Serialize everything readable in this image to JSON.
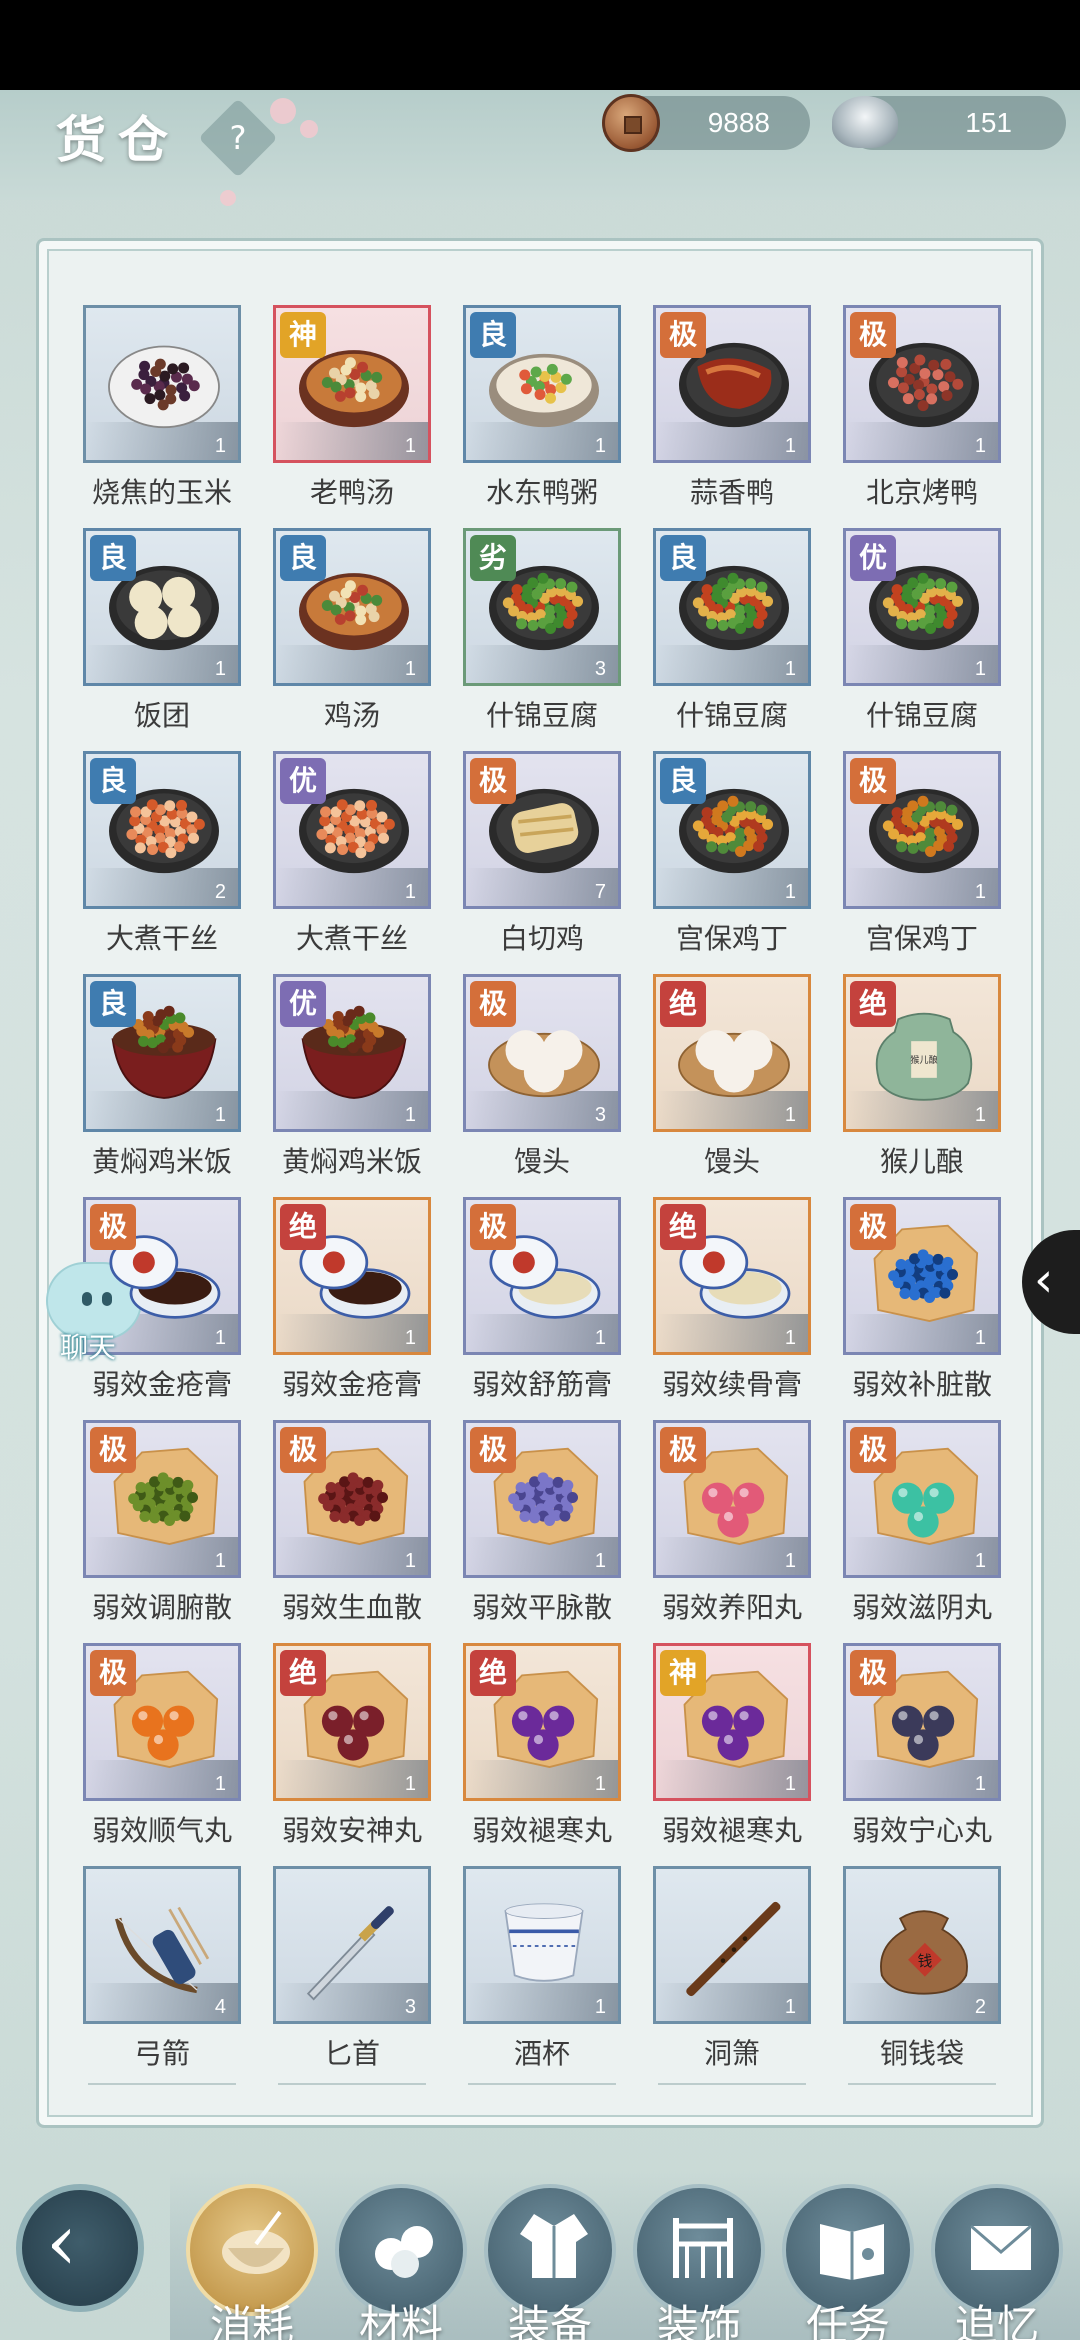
{
  "header": {
    "title": "货仓",
    "help": "?"
  },
  "currency": {
    "copper": "9888",
    "silver": "151"
  },
  "chat": {
    "label": "聊天"
  },
  "side": {
    "toggle": "‹"
  },
  "items": [
    {
      "name": "烧焦的玉米",
      "qty": "1",
      "rank": "",
      "art": "corn"
    },
    {
      "name": "老鸭汤",
      "qty": "1",
      "rank": "神",
      "art": "soup"
    },
    {
      "name": "水东鸭粥",
      "qty": "1",
      "rank": "良",
      "art": "porridge"
    },
    {
      "name": "蒜香鸭",
      "qty": "1",
      "rank": "极",
      "art": "duck"
    },
    {
      "name": "北京烤鸭",
      "qty": "1",
      "rank": "极",
      "art": "roast"
    },
    {
      "name": "饭团",
      "qty": "1",
      "rank": "良",
      "art": "riceball"
    },
    {
      "name": "鸡汤",
      "qty": "1",
      "rank": "良",
      "art": "soup"
    },
    {
      "name": "什锦豆腐",
      "qty": "3",
      "rank": "劣",
      "art": "stirfry"
    },
    {
      "name": "什锦豆腐",
      "qty": "1",
      "rank": "良",
      "art": "stirfry"
    },
    {
      "name": "什锦豆腐",
      "qty": "1",
      "rank": "优",
      "art": "stirfry"
    },
    {
      "name": "大煮干丝",
      "qty": "2",
      "rank": "良",
      "art": "noodle"
    },
    {
      "name": "大煮干丝",
      "qty": "1",
      "rank": "优",
      "art": "noodle"
    },
    {
      "name": "白切鸡",
      "qty": "7",
      "rank": "极",
      "art": "chicken"
    },
    {
      "name": "宫保鸡丁",
      "qty": "1",
      "rank": "良",
      "art": "kungpao"
    },
    {
      "name": "宫保鸡丁",
      "qty": "1",
      "rank": "极",
      "art": "kungpao"
    },
    {
      "name": "黄焖鸡米饭",
      "qty": "1",
      "rank": "良",
      "art": "bowl"
    },
    {
      "name": "黄焖鸡米饭",
      "qty": "1",
      "rank": "优",
      "art": "bowl"
    },
    {
      "name": "馒头",
      "qty": "3",
      "rank": "极",
      "art": "bun"
    },
    {
      "name": "馒头",
      "qty": "1",
      "rank": "绝",
      "art": "bun"
    },
    {
      "name": "猴儿酿",
      "qty": "1",
      "rank": "绝",
      "art": "jar",
      "jar_text": "猴儿酿"
    },
    {
      "name": "弱效金疮膏",
      "qty": "1",
      "rank": "极",
      "art": "ointment-dark"
    },
    {
      "name": "弱效金疮膏",
      "qty": "1",
      "rank": "绝",
      "art": "ointment-dark"
    },
    {
      "name": "弱效舒筋膏",
      "qty": "1",
      "rank": "极",
      "art": "ointment-light"
    },
    {
      "name": "弱效续骨膏",
      "qty": "1",
      "rank": "绝",
      "art": "ointment-light"
    },
    {
      "name": "弱效补脏散",
      "qty": "1",
      "rank": "极",
      "art": "powder-blue"
    },
    {
      "name": "弱效调腑散",
      "qty": "1",
      "rank": "极",
      "art": "powder-green"
    },
    {
      "name": "弱效生血散",
      "qty": "1",
      "rank": "极",
      "art": "powder-red"
    },
    {
      "name": "弱效平脉散",
      "qty": "1",
      "rank": "极",
      "art": "powder-violet"
    },
    {
      "name": "弱效养阳丸",
      "qty": "1",
      "rank": "极",
      "art": "pill-pink"
    },
    {
      "name": "弱效滋阴丸",
      "qty": "1",
      "rank": "极",
      "art": "pill-teal"
    },
    {
      "name": "弱效顺气丸",
      "qty": "1",
      "rank": "极",
      "art": "pill-orange"
    },
    {
      "name": "弱效安神丸",
      "qty": "1",
      "rank": "绝",
      "art": "pill-maroon"
    },
    {
      "name": "弱效褪寒丸",
      "qty": "1",
      "rank": "绝",
      "art": "pill-purple"
    },
    {
      "name": "弱效褪寒丸",
      "qty": "1",
      "rank": "神",
      "art": "pill-purple"
    },
    {
      "name": "弱效宁心丸",
      "qty": "1",
      "rank": "极",
      "art": "pill-navy"
    },
    {
      "name": "弓箭",
      "qty": "4",
      "rank": "",
      "art": "bow"
    },
    {
      "name": "匕首",
      "qty": "3",
      "rank": "",
      "art": "dagger"
    },
    {
      "name": "酒杯",
      "qty": "1",
      "rank": "",
      "art": "cup"
    },
    {
      "name": "洞箫",
      "qty": "1",
      "rank": "",
      "art": "flute"
    },
    {
      "name": "铜钱袋",
      "qty": "2",
      "rank": "",
      "art": "bag",
      "bag_text": "钱"
    }
  ],
  "rank_colors": {
    "神": "#e2a427",
    "良": "#3f7cb0",
    "极": "#d46f3a",
    "优": "#7d6db3",
    "劣": "#4f8a55",
    "绝": "#c4423d"
  },
  "nav": {
    "back": "‹",
    "tabs": [
      {
        "label": "消耗",
        "icon": "bowl-icon",
        "active": true
      },
      {
        "label": "材料",
        "icon": "materials-icon",
        "active": false
      },
      {
        "label": "装备",
        "icon": "robe-icon",
        "active": false
      },
      {
        "label": "装饰",
        "icon": "bridge-icon",
        "active": false
      },
      {
        "label": "任务",
        "icon": "book-icon",
        "active": false
      },
      {
        "label": "追忆",
        "icon": "letter-icon",
        "active": false
      }
    ]
  }
}
